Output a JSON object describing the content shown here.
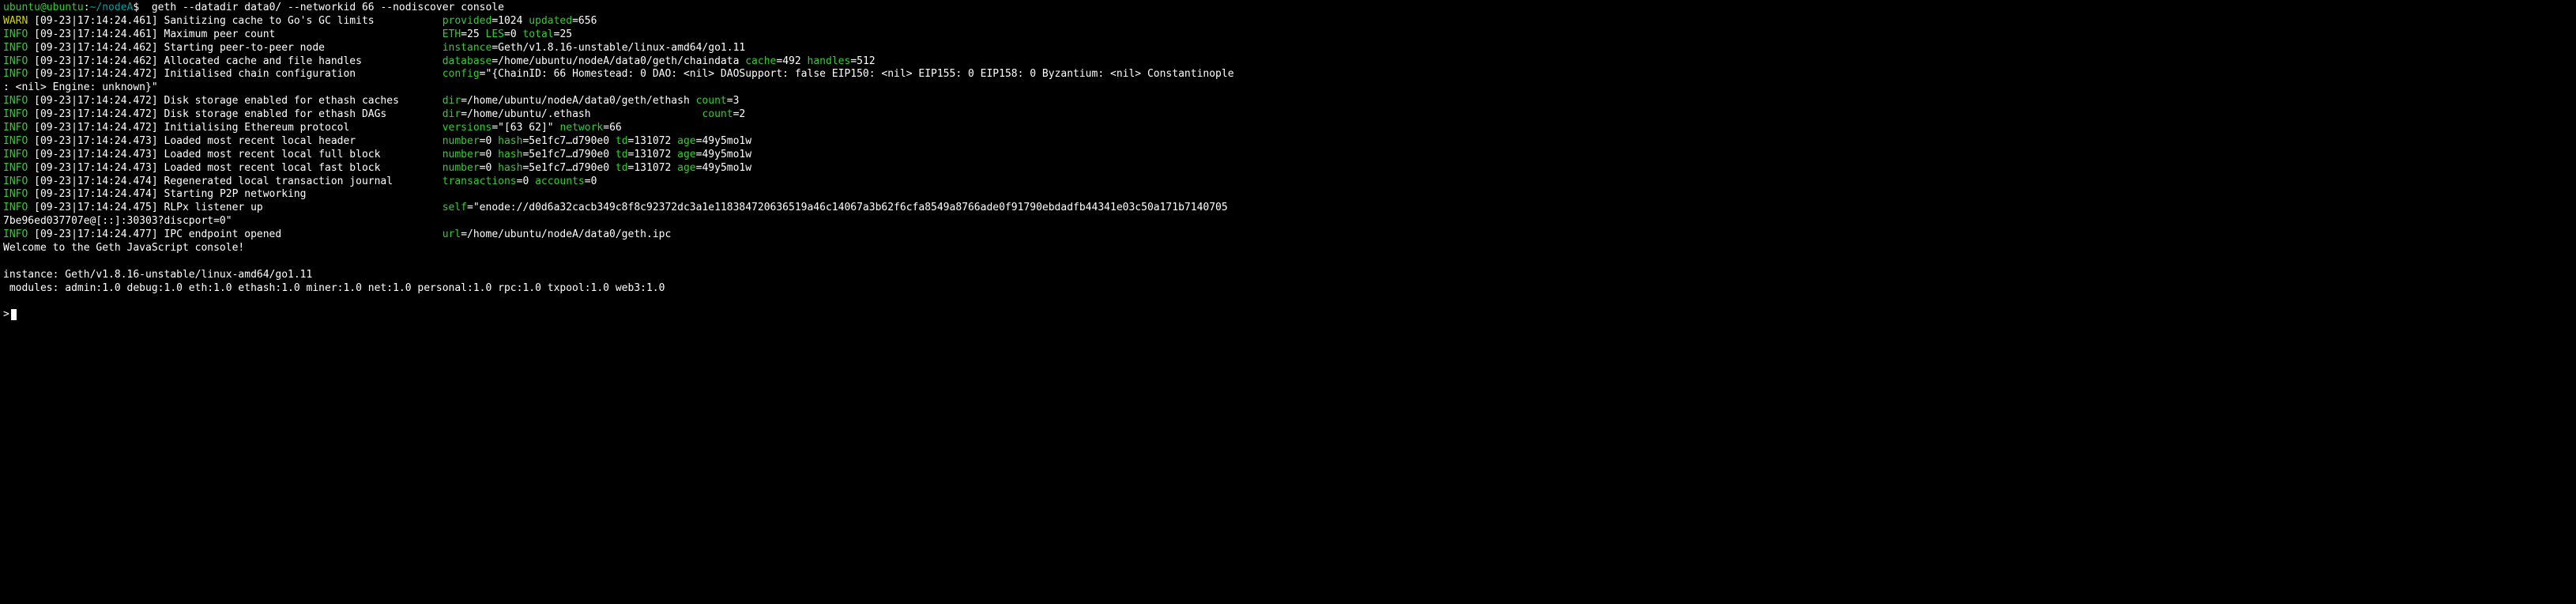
{
  "prompt": {
    "userhost": "ubuntu@ubuntu",
    "colon": ":",
    "cwd": "~/nodeA",
    "dollar": "$  ",
    "command": "geth --datadir data0/ --networkid 66 --nodiscover console"
  },
  "logs": [
    {
      "level": "WARN",
      "ts": " [09-23|17:14:24.461] ",
      "msg": "Sanitizing cache to Go's GC limits           ",
      "kv": [
        {
          "k": "provided",
          "eq": "=",
          "v": "1024 "
        },
        {
          "k": "updated",
          "eq": "=",
          "v": "656"
        }
      ]
    },
    {
      "level": "INFO",
      "ts": " [09-23|17:14:24.461] ",
      "msg": "Maximum peer count                           ",
      "kv": [
        {
          "k": "ETH",
          "eq": "=",
          "v": "25 "
        },
        {
          "k": "LES",
          "eq": "=",
          "v": "0 "
        },
        {
          "k": "total",
          "eq": "=",
          "v": "25"
        }
      ]
    },
    {
      "level": "INFO",
      "ts": " [09-23|17:14:24.462] ",
      "msg": "Starting peer-to-peer node                   ",
      "kv": [
        {
          "k": "instance",
          "eq": "=",
          "v": "Geth/v1.8.16-unstable/linux-amd64/go1.11"
        }
      ]
    },
    {
      "level": "INFO",
      "ts": " [09-23|17:14:24.462] ",
      "msg": "Allocated cache and file handles             ",
      "kv": [
        {
          "k": "database",
          "eq": "=",
          "v": "/home/ubuntu/nodeA/data0/geth/chaindata "
        },
        {
          "k": "cache",
          "eq": "=",
          "v": "492 "
        },
        {
          "k": "handles",
          "eq": "=",
          "v": "512"
        }
      ]
    },
    {
      "level": "INFO",
      "ts": " [09-23|17:14:24.472] ",
      "msg": "Initialised chain configuration              ",
      "kv": [
        {
          "k": "config",
          "eq": "=",
          "v": "\"{ChainID: 66 Homestead: 0 DAO: <nil> DAOSupport: false EIP150: <nil> EIP155: 0 EIP158: 0 Byzantium: <nil> Constantinople"
        }
      ],
      "cont": ": <nil> Engine: unknown}\""
    },
    {
      "level": "INFO",
      "ts": " [09-23|17:14:24.472] ",
      "msg": "Disk storage enabled for ethash caches       ",
      "kv": [
        {
          "k": "dir",
          "eq": "=",
          "v": "/home/ubuntu/nodeA/data0/geth/ethash "
        },
        {
          "k": "count",
          "eq": "=",
          "v": "3"
        }
      ]
    },
    {
      "level": "INFO",
      "ts": " [09-23|17:14:24.472] ",
      "msg": "Disk storage enabled for ethash DAGs         ",
      "kv": [
        {
          "k": "dir",
          "eq": "=",
          "v": "/home/ubuntu/.ethash                  "
        },
        {
          "k": "count",
          "eq": "=",
          "v": "2"
        }
      ]
    },
    {
      "level": "INFO",
      "ts": " [09-23|17:14:24.472] ",
      "msg": "Initialising Ethereum protocol               ",
      "kv": [
        {
          "k": "versions",
          "eq": "=",
          "v": "\"[63 62]\" "
        },
        {
          "k": "network",
          "eq": "=",
          "v": "66"
        }
      ]
    },
    {
      "level": "INFO",
      "ts": " [09-23|17:14:24.473] ",
      "msg": "Loaded most recent local header              ",
      "kv": [
        {
          "k": "number",
          "eq": "=",
          "v": "0 "
        },
        {
          "k": "hash",
          "eq": "=",
          "v": "5e1fc7…d790e0 "
        },
        {
          "k": "td",
          "eq": "=",
          "v": "131072 "
        },
        {
          "k": "age",
          "eq": "=",
          "v": "49y5mo1w"
        }
      ]
    },
    {
      "level": "INFO",
      "ts": " [09-23|17:14:24.473] ",
      "msg": "Loaded most recent local full block          ",
      "kv": [
        {
          "k": "number",
          "eq": "=",
          "v": "0 "
        },
        {
          "k": "hash",
          "eq": "=",
          "v": "5e1fc7…d790e0 "
        },
        {
          "k": "td",
          "eq": "=",
          "v": "131072 "
        },
        {
          "k": "age",
          "eq": "=",
          "v": "49y5mo1w"
        }
      ]
    },
    {
      "level": "INFO",
      "ts": " [09-23|17:14:24.473] ",
      "msg": "Loaded most recent local fast block          ",
      "kv": [
        {
          "k": "number",
          "eq": "=",
          "v": "0 "
        },
        {
          "k": "hash",
          "eq": "=",
          "v": "5e1fc7…d790e0 "
        },
        {
          "k": "td",
          "eq": "=",
          "v": "131072 "
        },
        {
          "k": "age",
          "eq": "=",
          "v": "49y5mo1w"
        }
      ]
    },
    {
      "level": "INFO",
      "ts": " [09-23|17:14:24.474] ",
      "msg": "Regenerated local transaction journal        ",
      "kv": [
        {
          "k": "transactions",
          "eq": "=",
          "v": "0 "
        },
        {
          "k": "accounts",
          "eq": "=",
          "v": "0"
        }
      ]
    },
    {
      "level": "INFO",
      "ts": " [09-23|17:14:24.474] ",
      "msg": "Starting P2P networking",
      "kv": []
    },
    {
      "level": "INFO",
      "ts": " [09-23|17:14:24.475] ",
      "msg": "RLPx listener up                             ",
      "kv": [
        {
          "k": "self",
          "eq": "=",
          "v": "\"enode://d0d6a32cacb349c8f8c92372dc3a1e118384720636519a46c14067a3b62f6cfa8549a8766ade0f91790ebdadfb44341e03c50a171b7140705"
        }
      ],
      "cont": "7be96ed037707e@[::]:30303?discport=0\""
    },
    {
      "level": "INFO",
      "ts": " [09-23|17:14:24.477] ",
      "msg": "IPC endpoint opened                          ",
      "kv": [
        {
          "k": "url",
          "eq": "=",
          "v": "/home/ubuntu/nodeA/data0/geth.ipc"
        }
      ]
    }
  ],
  "footer": {
    "welcome": "Welcome to the Geth JavaScript console!",
    "blank1": " ",
    "instance": "instance: Geth/v1.8.16-unstable/linux-amd64/go1.11",
    "modules": " modules: admin:1.0 debug:1.0 eth:1.0 ethash:1.0 miner:1.0 net:1.0 personal:1.0 rpc:1.0 txpool:1.0 web3:1.0",
    "blank2": " ",
    "prompt": ">"
  },
  "colors": {
    "INFO": "green",
    "WARN": "yellow"
  }
}
